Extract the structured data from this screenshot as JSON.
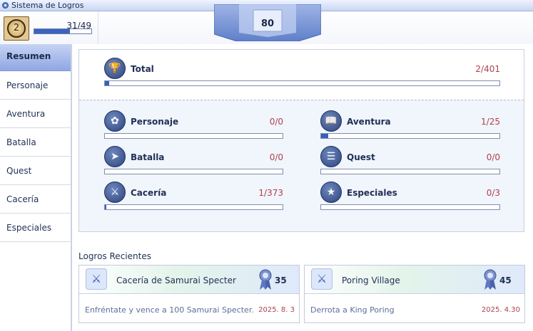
{
  "window": {
    "title": "Sistema de Logros"
  },
  "header": {
    "level": "2",
    "progress_text": "31/49",
    "progress_fraction": 0.63,
    "banner_value": "80"
  },
  "sidebar": {
    "items": [
      {
        "label": "Resumen",
        "active": true
      },
      {
        "label": "Personaje"
      },
      {
        "label": "Aventura"
      },
      {
        "label": "Batalla"
      },
      {
        "label": "Quest"
      },
      {
        "label": "Cacería"
      },
      {
        "label": "Especiales"
      }
    ]
  },
  "summary": {
    "total": {
      "label": "Total",
      "count": "2/401",
      "fraction": 0.005,
      "icon": "trophy-icon"
    },
    "categories": [
      {
        "label": "Personaje",
        "count": "0/0",
        "fraction": 0,
        "icon": "laurel-icon"
      },
      {
        "label": "Aventura",
        "count": "1/25",
        "fraction": 0.04,
        "icon": "book-icon"
      },
      {
        "label": "Batalla",
        "count": "0/0",
        "fraction": 0,
        "icon": "cursor-icon"
      },
      {
        "label": "Quest",
        "count": "0/0",
        "fraction": 0,
        "icon": "scroll-icon"
      },
      {
        "label": "Cacería",
        "count": "1/373",
        "fraction": 0.003,
        "icon": "sword-icon"
      },
      {
        "label": "Especiales",
        "count": "0/3",
        "fraction": 0,
        "icon": "star-medal-icon"
      }
    ]
  },
  "recent": {
    "title": "Logros Recientes",
    "cards": [
      {
        "name": "Cacería de Samurai Specter",
        "points": "35",
        "description": "Enfréntate y vence a 100 Samurai Specter.",
        "date": "2025. 8. 3"
      },
      {
        "name": "Poring Village",
        "points": "45",
        "description": "Derrota a King Poring",
        "date": "2025. 4.30"
      }
    ]
  },
  "colors": {
    "accent": "#3a5fb8",
    "count_text": "#b0404a",
    "sidebar_active": "#8fa7e3"
  }
}
